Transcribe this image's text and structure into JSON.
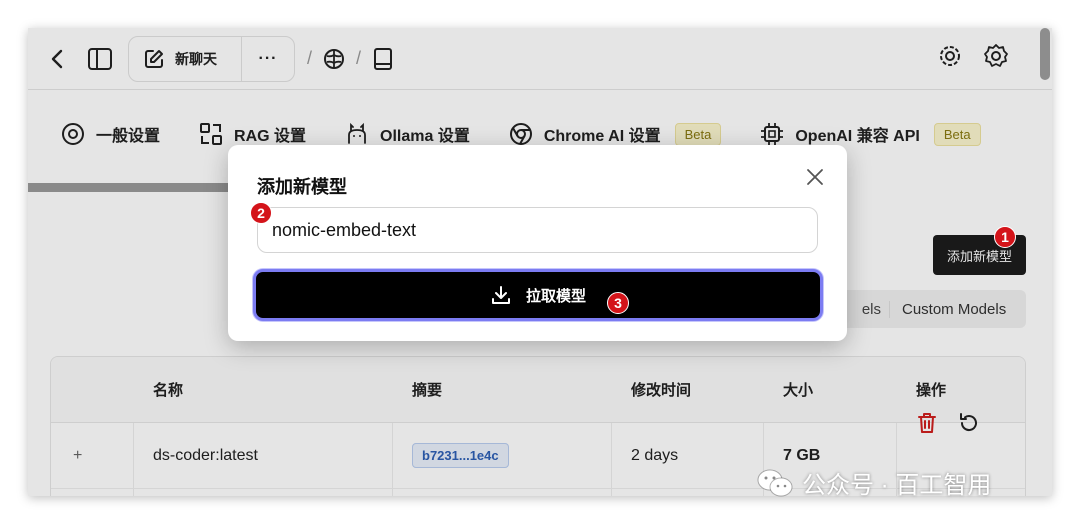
{
  "topbar": {
    "chat_label": "新聊天",
    "more_label": "···",
    "sep1": "/",
    "sep2": "/"
  },
  "tabs": [
    {
      "label": "一般设置",
      "icon": "gear-outline-icon"
    },
    {
      "label": "RAG 设置",
      "icon": "scan-icon"
    },
    {
      "label": "Ollama 设置",
      "icon": "llama-icon"
    },
    {
      "label": "Chrome AI 设置",
      "icon": "chrome-icon",
      "badge": "Beta"
    },
    {
      "label": "OpenAI 兼容 API",
      "icon": "chip-icon",
      "badge": "Beta"
    }
  ],
  "content": {
    "add_model_label": "添加新模型",
    "segment_left": "els",
    "segment_right": "Custom Models"
  },
  "table": {
    "headers": [
      "名称",
      "摘要",
      "修改时间",
      "大小",
      "操作"
    ],
    "rows": [
      {
        "expand": "+",
        "name": "ds-coder:latest",
        "digest": "b7231...1e4c",
        "modified": "2 days",
        "size": "7 GB"
      }
    ]
  },
  "modal": {
    "title": "添加新模型",
    "input_value": "nomic-embed-text",
    "pull_label": "拉取模型"
  },
  "badges": {
    "one": "1",
    "two": "2",
    "three": "3"
  },
  "watermark": {
    "text": "公众号 · 百工智用"
  },
  "colors": {
    "badge": "#d4141a",
    "beta_bg": "#fbf5cf",
    "focus_ring": "#7c7cf2"
  }
}
